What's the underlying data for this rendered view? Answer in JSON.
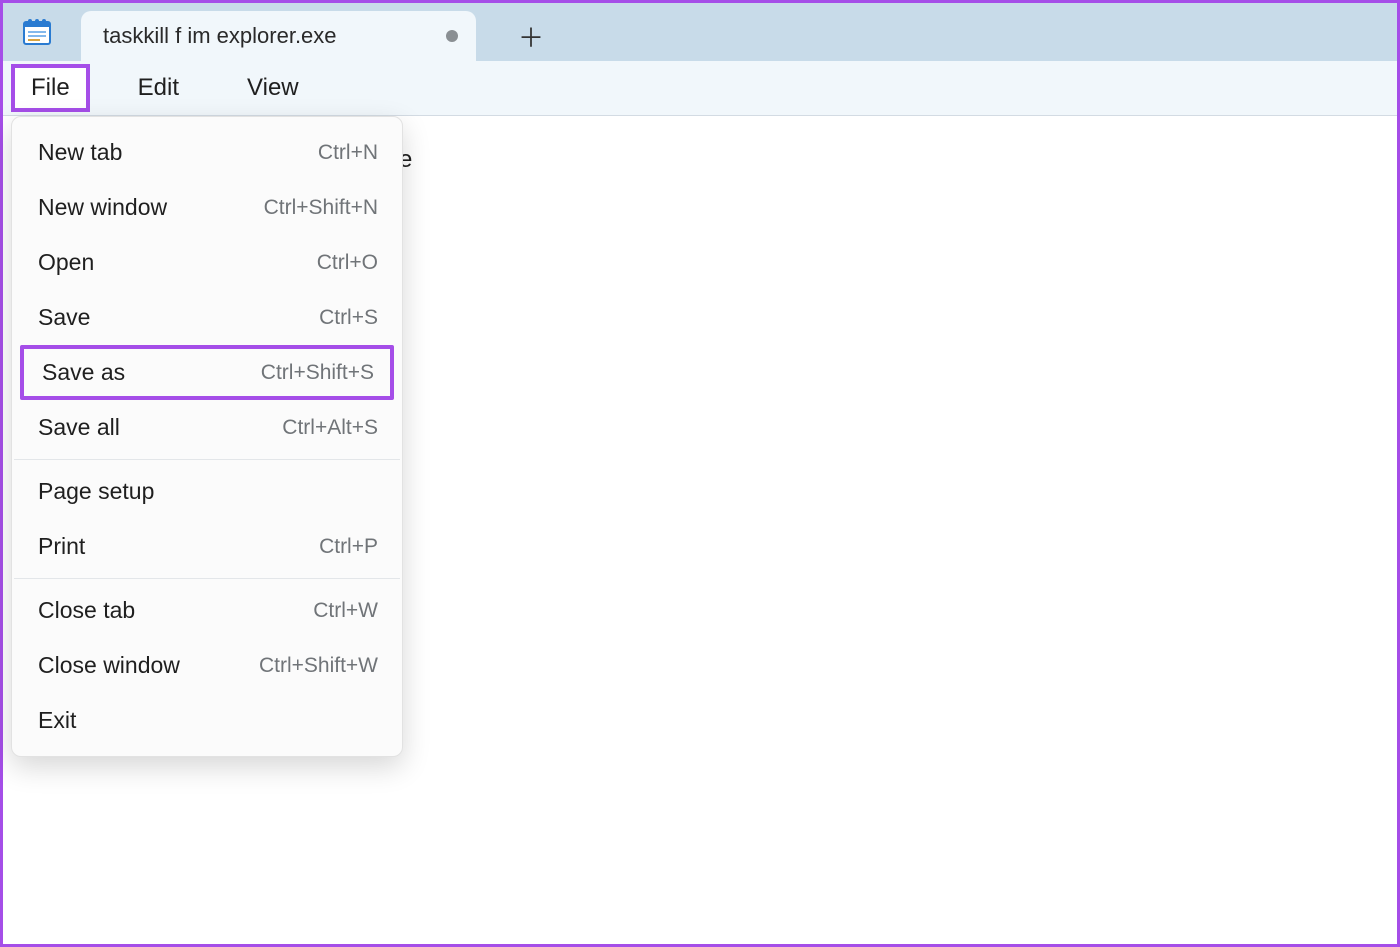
{
  "tab": {
    "title": "taskkill f im explorer.exe",
    "dirty": true
  },
  "menubar": {
    "items": [
      {
        "label": "File",
        "highlighted": true
      },
      {
        "label": "Edit",
        "highlighted": false
      },
      {
        "label": "View",
        "highlighted": false
      }
    ]
  },
  "editor": {
    "visible_fragment": "e"
  },
  "file_menu": {
    "groups": [
      [
        {
          "label": "New tab",
          "shortcut": "Ctrl+N",
          "highlighted": false,
          "name": "file-menu-new-tab"
        },
        {
          "label": "New window",
          "shortcut": "Ctrl+Shift+N",
          "highlighted": false,
          "name": "file-menu-new-window"
        },
        {
          "label": "Open",
          "shortcut": "Ctrl+O",
          "highlighted": false,
          "name": "file-menu-open"
        },
        {
          "label": "Save",
          "shortcut": "Ctrl+S",
          "highlighted": false,
          "name": "file-menu-save"
        },
        {
          "label": "Save as",
          "shortcut": "Ctrl+Shift+S",
          "highlighted": true,
          "name": "file-menu-save-as"
        },
        {
          "label": "Save all",
          "shortcut": "Ctrl+Alt+S",
          "highlighted": false,
          "name": "file-menu-save-all"
        }
      ],
      [
        {
          "label": "Page setup",
          "shortcut": "",
          "highlighted": false,
          "name": "file-menu-page-setup"
        },
        {
          "label": "Print",
          "shortcut": "Ctrl+P",
          "highlighted": false,
          "name": "file-menu-print"
        }
      ],
      [
        {
          "label": "Close tab",
          "shortcut": "Ctrl+W",
          "highlighted": false,
          "name": "file-menu-close-tab"
        },
        {
          "label": "Close window",
          "shortcut": "Ctrl+Shift+W",
          "highlighted": false,
          "name": "file-menu-close-window"
        },
        {
          "label": "Exit",
          "shortcut": "",
          "highlighted": false,
          "name": "file-menu-exit"
        }
      ]
    ]
  },
  "colors": {
    "highlight_border": "#a54ee8",
    "tabstrip_bg": "#c8dbe9",
    "chrome_bg": "#f1f7fb"
  }
}
